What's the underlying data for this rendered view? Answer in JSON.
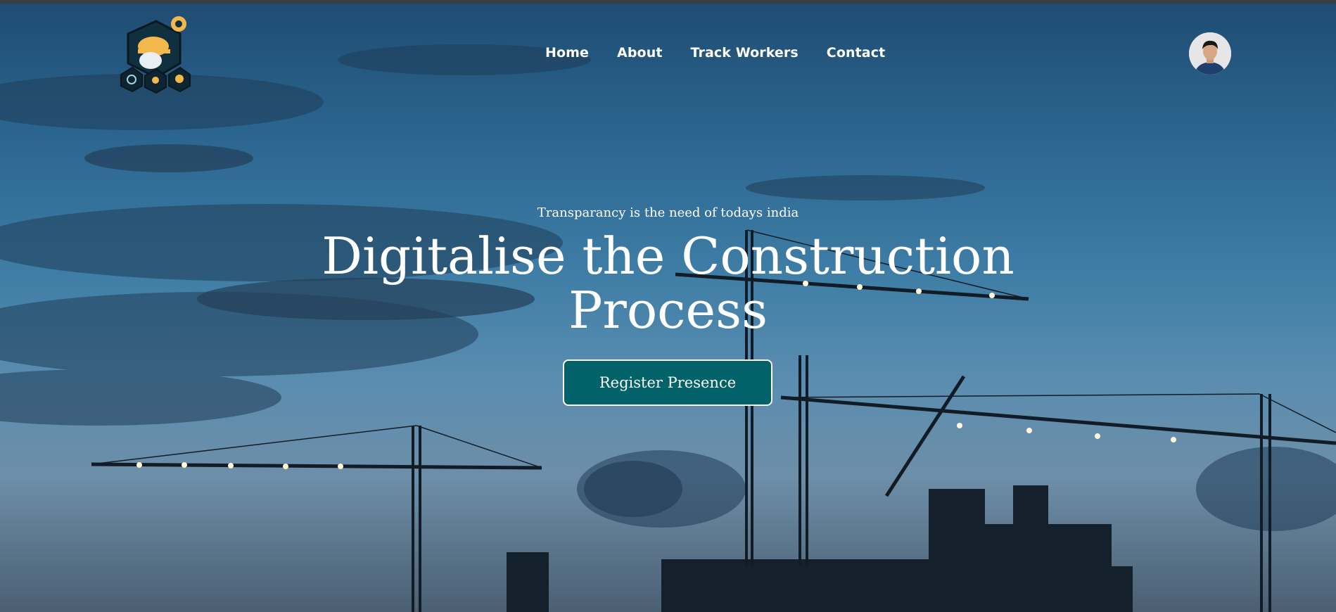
{
  "brand": {
    "logo_icon": "construction-worker-shield-logo",
    "accent_color": "#f2b84b"
  },
  "nav": {
    "items": [
      {
        "label": "Home"
      },
      {
        "label": "About"
      },
      {
        "label": "Track Workers"
      },
      {
        "label": "Contact"
      }
    ]
  },
  "user": {
    "avatar_icon": "user-avatar"
  },
  "hero": {
    "tagline": "Transparancy is the need of todays india",
    "title_line1": "Digitalise the Construction",
    "title_line2": "Process",
    "cta_label": "Register Presence",
    "cta_color": "#02626a",
    "background": "construction-cranes-dusk-photo"
  }
}
